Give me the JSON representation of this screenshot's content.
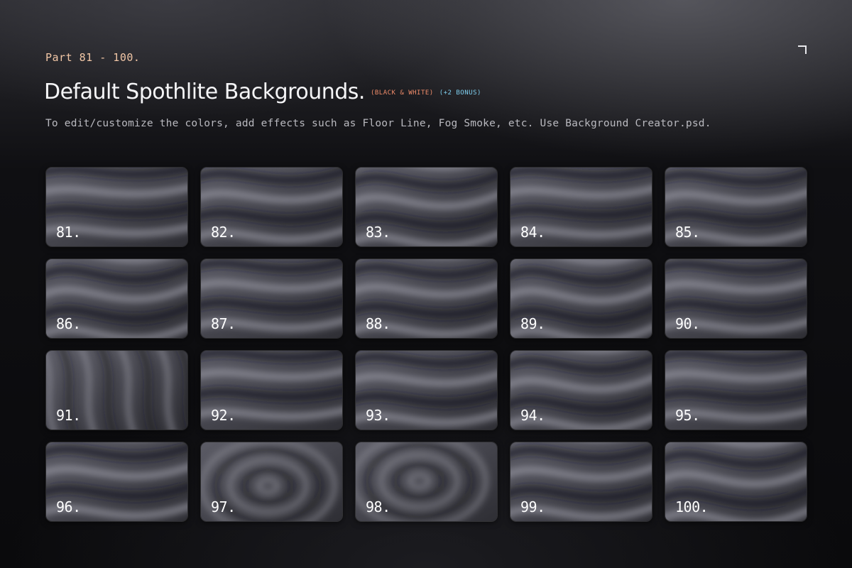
{
  "header": {
    "part": "Part 81 - 100.",
    "title": "Default Spothlite Backgrounds.",
    "tag_bw": "(BLACK & WHITE)",
    "tag_bonus": "(+2 BONUS)",
    "subtitle": "To edit/customize the colors, add effects such as Floor Line, Fog Smoke, etc. Use Background Creator.psd."
  },
  "colors": {
    "part_text": "#f2c7a6",
    "tag_bw": "#f08c6a",
    "tag_bonus": "#7fd0f0",
    "title": "#f5f5f7",
    "subtitle": "#b9b9bf"
  },
  "backgrounds": [
    {
      "label": "81."
    },
    {
      "label": "82."
    },
    {
      "label": "83."
    },
    {
      "label": "84."
    },
    {
      "label": "85."
    },
    {
      "label": "86."
    },
    {
      "label": "87."
    },
    {
      "label": "88."
    },
    {
      "label": "89."
    },
    {
      "label": "90."
    },
    {
      "label": "91."
    },
    {
      "label": "92."
    },
    {
      "label": "93."
    },
    {
      "label": "94."
    },
    {
      "label": "95."
    },
    {
      "label": "96."
    },
    {
      "label": "97."
    },
    {
      "label": "98."
    },
    {
      "label": "99."
    },
    {
      "label": "100."
    }
  ]
}
